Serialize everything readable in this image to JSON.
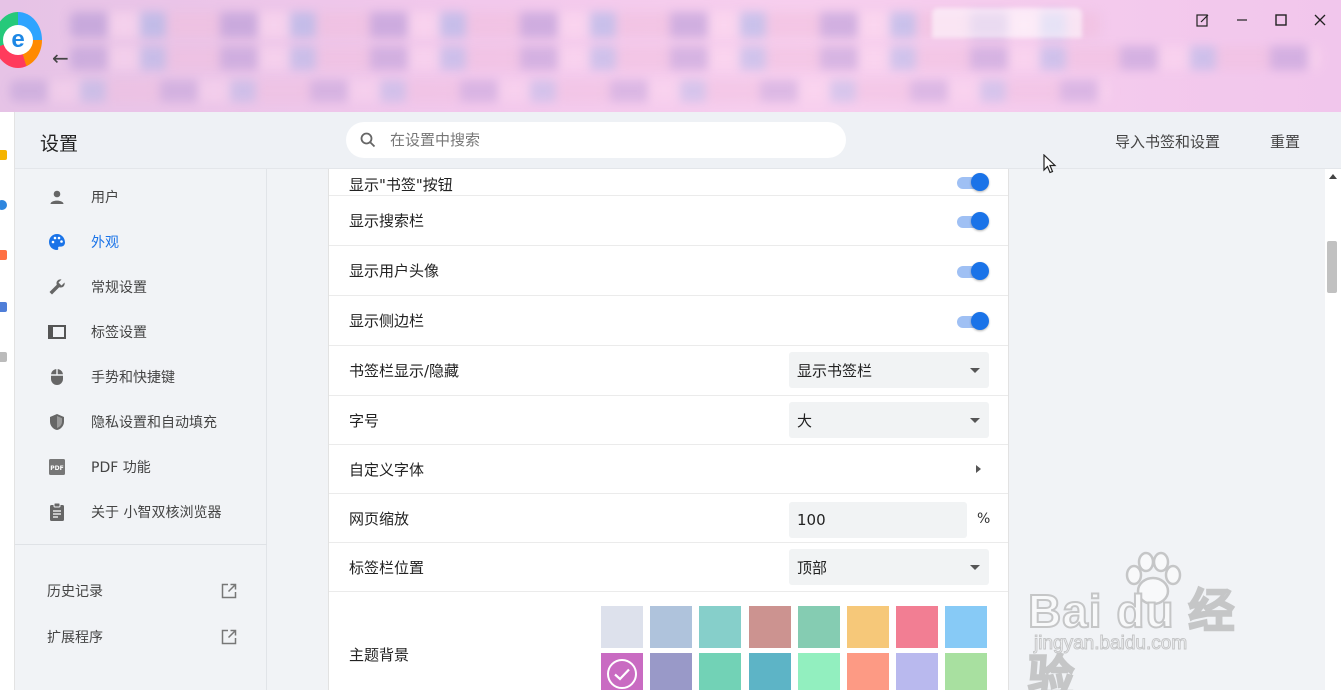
{
  "header": {
    "title": "设置",
    "search_placeholder": "在设置中搜索",
    "import_label": "导入书签和设置",
    "reset_label": "重置"
  },
  "sidebar": {
    "items": [
      {
        "label": "用户",
        "icon": "person-icon"
      },
      {
        "label": "外观",
        "icon": "palette-icon",
        "active": true
      },
      {
        "label": "常规设置",
        "icon": "wrench-icon"
      },
      {
        "label": "标签设置",
        "icon": "tab-icon"
      },
      {
        "label": "手势和快捷键",
        "icon": "mouse-icon"
      },
      {
        "label": "隐私设置和自动填充",
        "icon": "shield-icon"
      },
      {
        "label": "PDF 功能",
        "icon": "pdf-icon"
      },
      {
        "label": "关于 小智双核浏览器",
        "icon": "clipboard-icon"
      }
    ],
    "links": [
      {
        "label": "历史记录",
        "icon": "external-link-icon"
      },
      {
        "label": "扩展程序",
        "icon": "external-link-icon"
      }
    ]
  },
  "settings": {
    "cut_row_label": "显示\"书签\"按钮",
    "show_search_bar": {
      "label": "显示搜索栏",
      "on": true
    },
    "show_avatar": {
      "label": "显示用户头像",
      "on": true
    },
    "show_sidebar": {
      "label": "显示侧边栏",
      "on": true
    },
    "bookmark_bar": {
      "label": "书签栏显示/隐藏",
      "value": "显示书签栏"
    },
    "font_size": {
      "label": "字号",
      "value": "大"
    },
    "custom_font": {
      "label": "自定义字体"
    },
    "page_zoom": {
      "label": "网页缩放",
      "value": "100",
      "unit": "%"
    },
    "tab_position": {
      "label": "标签栏位置",
      "value": "顶部"
    },
    "theme_bg": {
      "label": "主题背景",
      "colors": [
        "#dde1ec",
        "#afc3dc",
        "#86cfca",
        "#cc9390",
        "#85ccb2",
        "#f6c879",
        "#f27e93",
        "#87caf6",
        "#c96bc2",
        "#9999c8",
        "#72d2b6",
        "#5db4c6",
        "#92efbf",
        "#fd9a84",
        "#b9b9ee",
        "#a8e0a0"
      ],
      "selected_index": 8
    }
  },
  "watermark": {
    "text": "Bai du 经验",
    "url": "jingyan.baidu.com"
  },
  "colors": {
    "accent": "#1a73e8",
    "toggle_track": "#9fc0f4"
  }
}
